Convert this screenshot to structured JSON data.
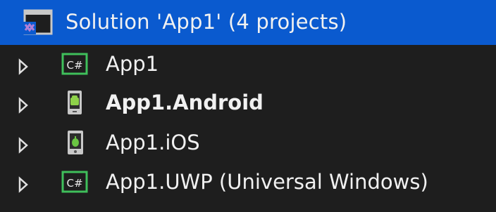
{
  "solution": {
    "label": "Solution 'App1' (4 projects)",
    "icon": "visual-studio-solution-icon"
  },
  "projects": [
    {
      "label": "App1",
      "icon": "csharp-project-icon",
      "bold": false
    },
    {
      "label": "App1.Android",
      "icon": "android-project-icon",
      "bold": true
    },
    {
      "label": "App1.iOS",
      "icon": "ios-project-icon",
      "bold": false
    },
    {
      "label": "App1.UWP (Universal Windows)",
      "icon": "csharp-project-icon",
      "bold": false
    }
  ],
  "colors": {
    "background": "#1e1e1e",
    "selection": "#0a5acf",
    "text": "#f1f1f1",
    "csharp_green": "#3fbf5b",
    "android_green": "#8ed14a",
    "ios_green": "#6ac542"
  }
}
